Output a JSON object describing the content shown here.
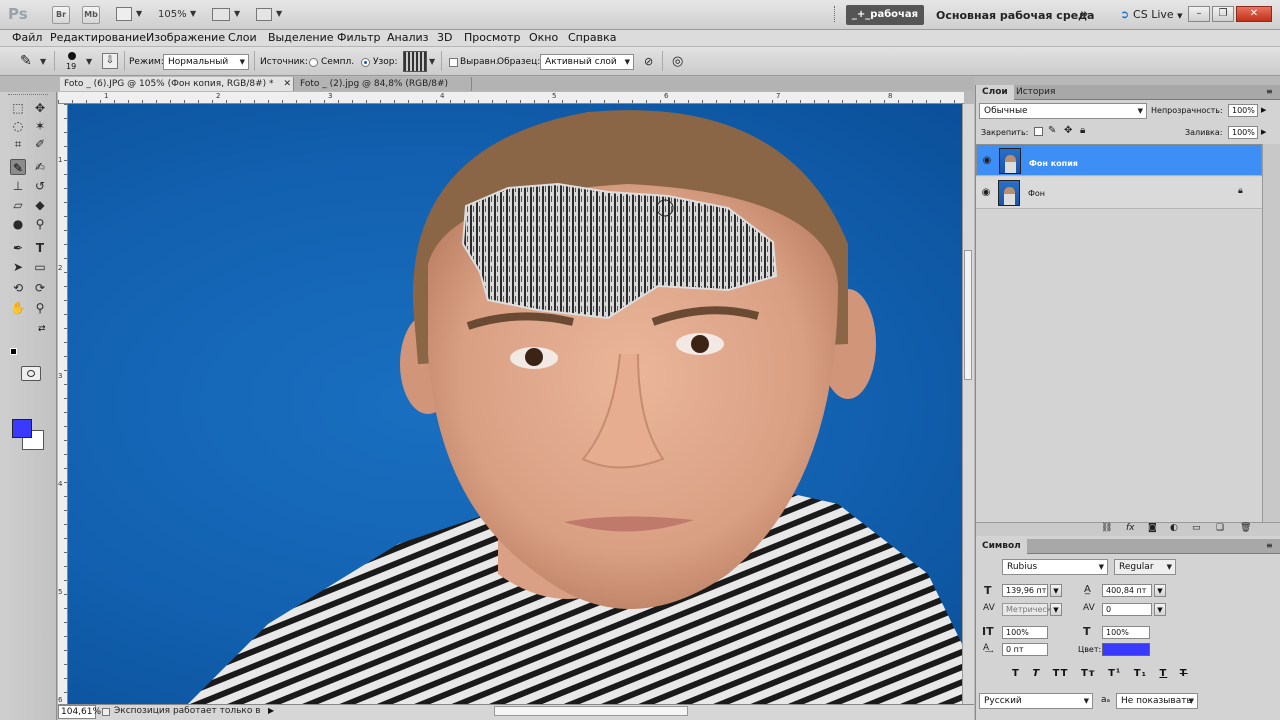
{
  "appbar": {
    "logo": "Ps",
    "br_label": "Br",
    "mb_label": "Mb",
    "zoom": "105%",
    "workspace_active": "_+_рабочая",
    "workspace_main": "Основная рабочая среда",
    "more": "»",
    "cslive": "CS Live"
  },
  "menu": [
    "Файл",
    "Редактирование",
    "Изображение",
    "Слои",
    "Выделение",
    "Фильтр",
    "Анализ",
    "3D",
    "Просмотр",
    "Окно",
    "Справка"
  ],
  "options": {
    "brush_size": "19",
    "mode_label": "Режим:",
    "mode_value": "Нормальный",
    "source_label": "Источник:",
    "sampled_label": "Семпл.",
    "pattern_label": "Узор:",
    "aligned_label": "Выравн.",
    "sample_label": "Образец:",
    "sample_value": "Активный слой"
  },
  "tabs": [
    {
      "label": "Foto _ (6).JPG @ 105% (Фон копия, RGB/8#) *"
    },
    {
      "label": "Foto _ (2).jpg @ 84,8% (RGB/8#) *"
    }
  ],
  "rulers": {
    "top": [
      "1",
      "2",
      "3",
      "4",
      "5",
      "6",
      "7",
      "8"
    ],
    "left": [
      "1",
      "2",
      "3",
      "4",
      "5",
      "6",
      "7"
    ]
  },
  "status": {
    "zoom": "104,61%",
    "text": "Экспозиция работает только в ..."
  },
  "layers_panel": {
    "tabs": [
      "Слои",
      "История"
    ],
    "blend": "Обычные",
    "opacity_label": "Непрозрачность:",
    "opacity": "100%",
    "lock_label": "Закрепить:",
    "fill_label": "Заливка:",
    "fill": "100%",
    "layers": [
      {
        "name": "Фон копия",
        "selected": true
      },
      {
        "name": "Фон",
        "selected": false
      }
    ]
  },
  "char_panel": {
    "tab": "Символ",
    "font": "Rubius",
    "style": "Regular",
    "size": "139,96 пт",
    "leading": "400,84 пт",
    "kerning": "Метрическ",
    "tracking": "0",
    "vscale": "100%",
    "hscale": "100%",
    "baseline": "0 пт",
    "color_label": "Цвет:",
    "color": "#3a3aff",
    "language": "Русский",
    "aa_label": "aₐ",
    "aa_value": "Не показывать"
  }
}
